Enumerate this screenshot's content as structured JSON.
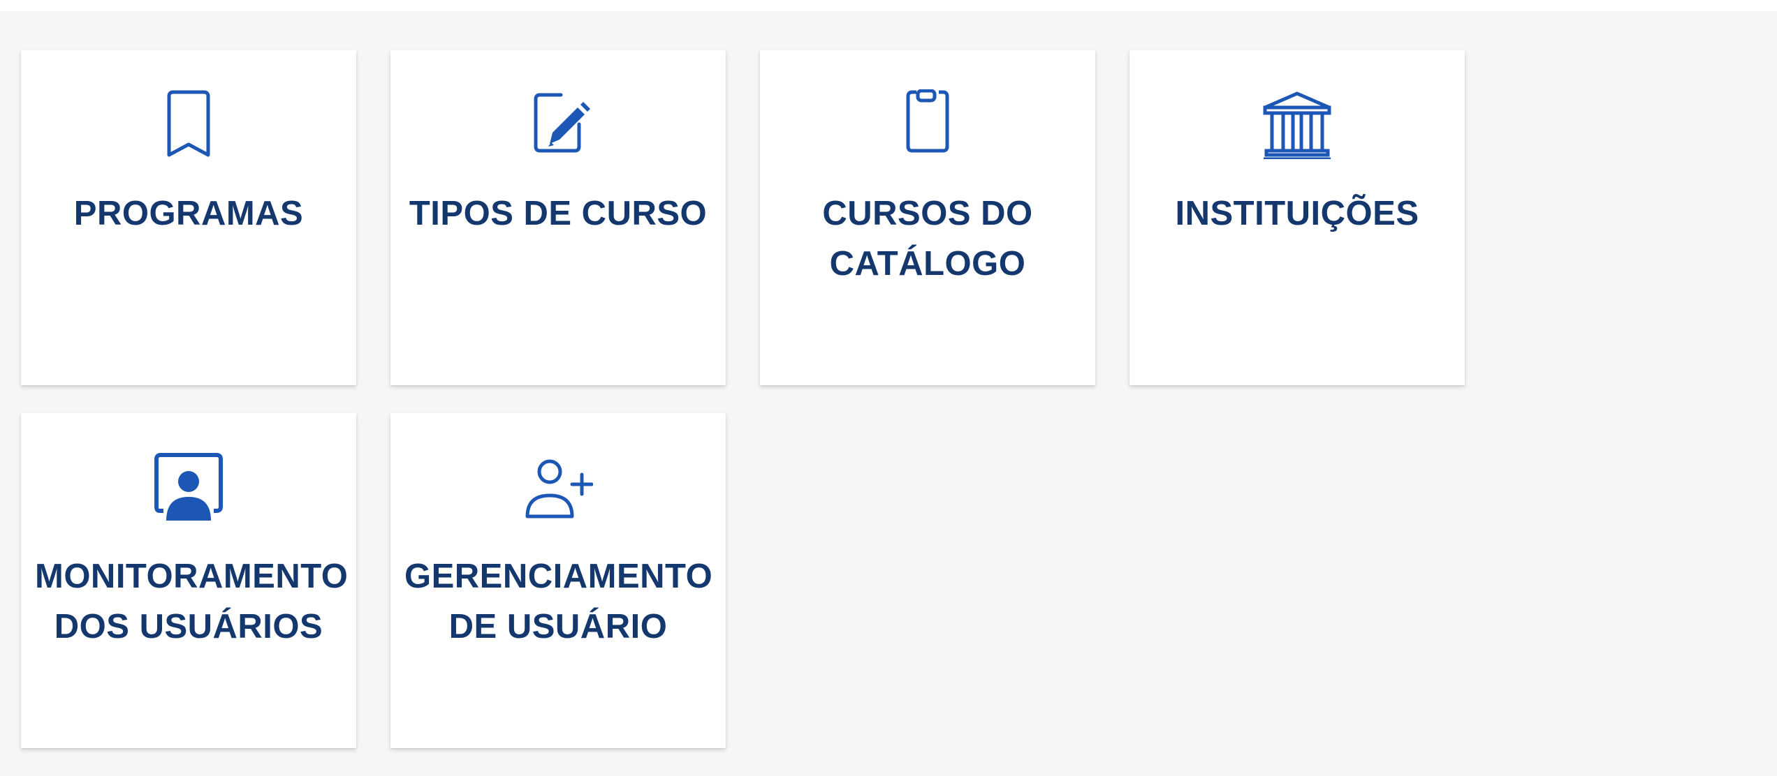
{
  "colors": {
    "icon": "#1c57b5",
    "label": "#14376e",
    "background": "#f6f6f6",
    "card": "#ffffff"
  },
  "cards": [
    {
      "label": "PROGRAMAS",
      "icon": "bookmark-icon"
    },
    {
      "label": "TIPOS DE CURSO",
      "icon": "edit-icon"
    },
    {
      "label": "CURSOS DO CATÁLOGO",
      "icon": "clipboard-icon"
    },
    {
      "label": "INSTITUIÇÕES",
      "icon": "institution-icon"
    },
    {
      "label": "MONITORAMENTO DOS USUÁRIOS",
      "icon": "user-monitor-icon"
    },
    {
      "label": "GERENCIAMENTO DE USUÁRIO",
      "icon": "add-user-icon"
    }
  ]
}
